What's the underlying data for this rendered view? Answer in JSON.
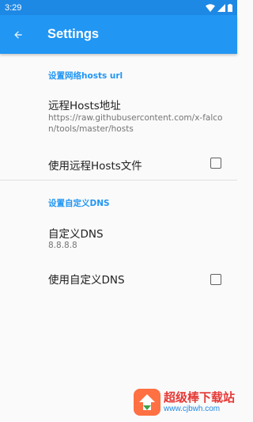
{
  "status_bar": {
    "time": "3:29"
  },
  "app_bar": {
    "title": "Settings"
  },
  "sections": {
    "hosts": {
      "header": "设置网络hosts url",
      "remote_hosts_url_title": "远程Hosts地址",
      "remote_hosts_url_summary": "https://raw.githubusercontent.com/x-falcon/tools/master/hosts",
      "use_remote_hosts_title": "使用远程Hosts文件",
      "use_remote_hosts_checked": false
    },
    "dns": {
      "header": "设置自定义DNS",
      "custom_dns_title": "自定义DNS",
      "custom_dns_summary": "8.8.8.8",
      "use_custom_dns_title": "使用自定义DNS",
      "use_custom_dns_checked": false
    }
  },
  "watermark": {
    "name": "超级棒下载站",
    "url": "www.cjbwh.com"
  },
  "colors": {
    "primary": "#2196f3",
    "status_bar": "#1e88e5",
    "accent": "#2196f3"
  }
}
